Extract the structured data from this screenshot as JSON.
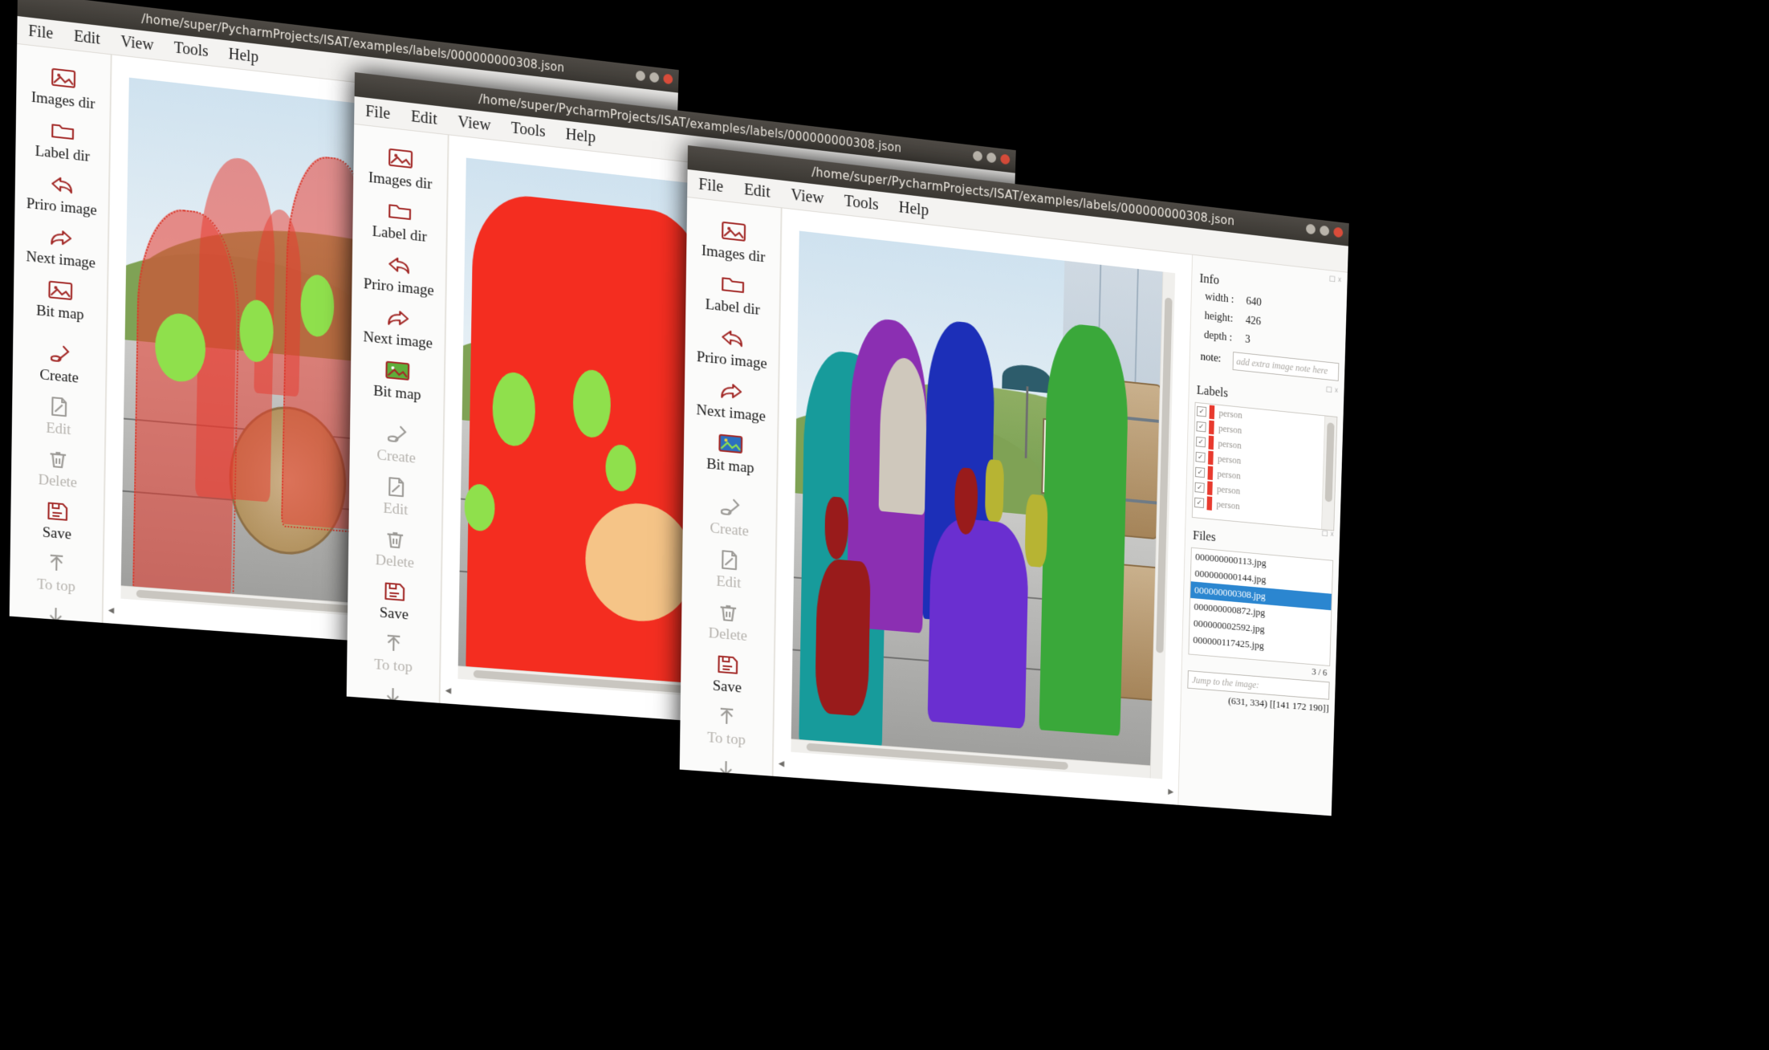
{
  "app": {
    "name": "ISAT",
    "title_path": "/home/super/PycharmProjects/ISAT/examples/labels/000000000308.json"
  },
  "menubar": {
    "items": [
      "File",
      "Edit",
      "View",
      "Tools",
      "Help"
    ]
  },
  "toolbar": {
    "items": [
      {
        "label": "Images dir",
        "icon": "image-folder-icon",
        "enabled": true
      },
      {
        "label": "Label dir",
        "icon": "folder-open-icon",
        "enabled": true
      },
      {
        "label": "Priro image",
        "icon": "arrow-back-icon",
        "enabled": true
      },
      {
        "label": "Next image",
        "icon": "arrow-forward-icon",
        "enabled": true
      },
      {
        "label": "Bit map",
        "icon": "bitmap-icon",
        "enabled": true
      },
      {
        "label": "Create",
        "icon": "polygon-create-icon",
        "enabled": true
      },
      {
        "label": "Edit",
        "icon": "edit-note-icon",
        "enabled": false
      },
      {
        "label": "Delete",
        "icon": "trash-icon",
        "enabled": false
      },
      {
        "label": "Save",
        "icon": "save-disk-icon",
        "enabled": true
      },
      {
        "label": "To top",
        "icon": "arrow-up-icon",
        "enabled": false
      },
      {
        "label": "To bottom",
        "icon": "arrow-down-icon",
        "enabled": false
      }
    ],
    "overflow_icon": "chevron-down-icon"
  },
  "info_panel": {
    "title": "Info",
    "width_label": "width :",
    "width_value": "640",
    "height_label": "height:",
    "height_value": "426",
    "depth_label": "depth :",
    "depth_value": "3",
    "note_label": "note:",
    "note_placeholder": "add extra image note here",
    "note_value": ""
  },
  "labels_panel": {
    "title": "Labels",
    "rows": [
      {
        "checked": true,
        "name": "person",
        "index": "1",
        "color": "#e83a2e"
      },
      {
        "checked": true,
        "name": "person",
        "index": "2",
        "color": "#e83a2e"
      },
      {
        "checked": true,
        "name": "person",
        "index": "3",
        "color": "#e83a2e"
      },
      {
        "checked": true,
        "name": "person",
        "index": "1",
        "color": "#e83a2e"
      },
      {
        "checked": true,
        "name": "person",
        "index": "4",
        "color": "#e83a2e"
      },
      {
        "checked": true,
        "name": "person",
        "index": "5",
        "color": "#e83a2e"
      },
      {
        "checked": true,
        "name": "person",
        "index": "6",
        "color": "#e83a2e"
      }
    ]
  },
  "files_panel": {
    "title": "Files",
    "files": [
      {
        "name": "000000000113.jpg",
        "selected": false
      },
      {
        "name": "000000000144.jpg",
        "selected": false
      },
      {
        "name": "000000000308.jpg",
        "selected": true
      },
      {
        "name": "000000000872.jpg",
        "selected": false
      },
      {
        "name": "000000002592.jpg",
        "selected": false
      },
      {
        "name": "000000117425.jpg",
        "selected": false
      }
    ],
    "counter": "3 / 6",
    "jump_placeholder": "Jump to the image:"
  },
  "statusbar": {
    "coords": "(631, 334) [[141 172 190]]"
  },
  "windows": [
    {
      "id": "w1",
      "mode": "semi-transparent-annotation-overlay"
    },
    {
      "id": "w2",
      "mode": "binary-bitmap-mask"
    },
    {
      "id": "w3",
      "mode": "instance-color-segmentation"
    }
  ],
  "palette": {
    "title_bar": "#3b3833",
    "accent_red": "#a32a28",
    "selection_blue": "#2b86d0",
    "mask_red": "#f42d20",
    "mask_green": "#7ee03c",
    "mask_orange": "#f5c487",
    "inst_teal": "#179b9b",
    "inst_purple": "#8b2fb2",
    "inst_blue": "#1c2fb8",
    "inst_green": "#3aa83a",
    "inst_violet": "#6a2fd0",
    "inst_darkred": "#991b1b",
    "inst_gray": "#cfc8bc",
    "inst_olive": "#b7b433"
  }
}
